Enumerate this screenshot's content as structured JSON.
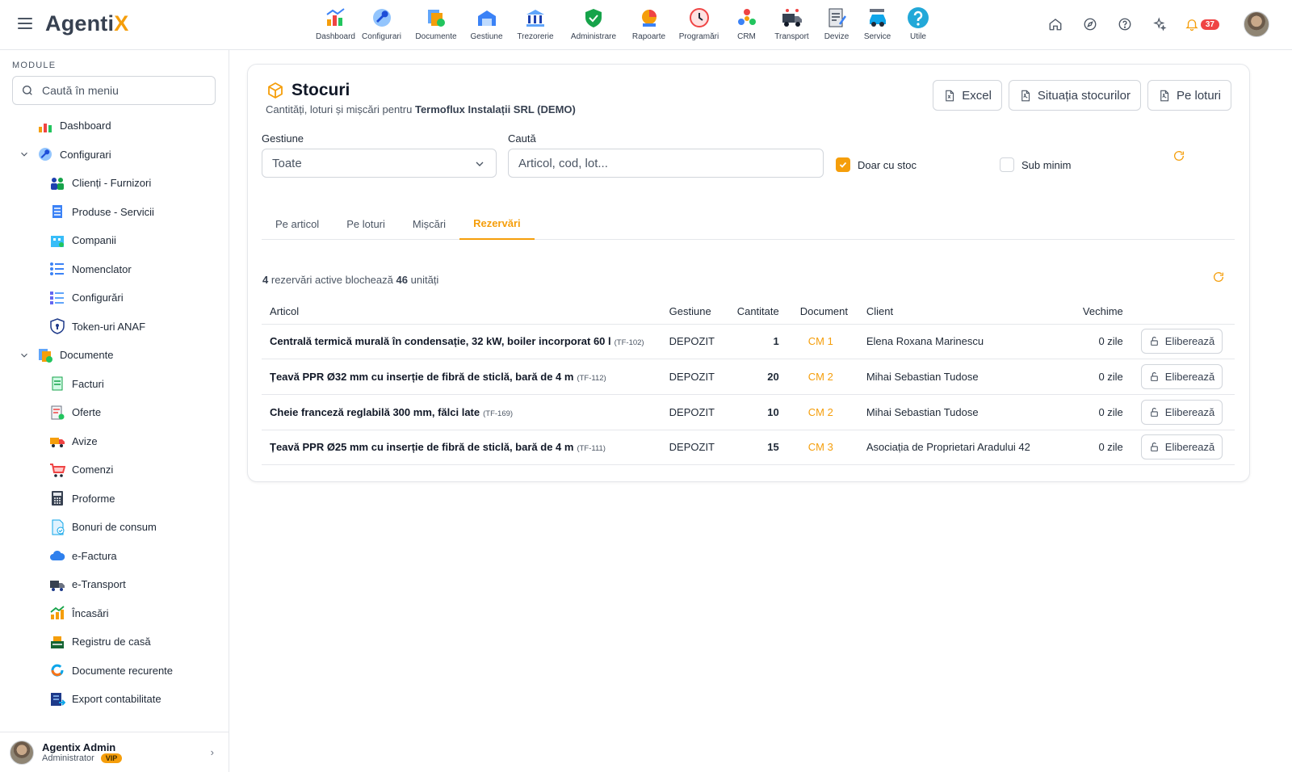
{
  "app": {
    "logo_main": "Agenti",
    "logo_accent": "X"
  },
  "modules": [
    {
      "label": "Dashboard",
      "icon": "dashboard-icon",
      "w": 47
    },
    {
      "label": "Configurari",
      "icon": "wrench-icon",
      "w": 67
    },
    {
      "label": "Documente",
      "icon": "documents-icon",
      "w": 68
    },
    {
      "label": "Gestiune",
      "icon": "warehouse-icon",
      "w": 57
    },
    {
      "label": "Trezorerie",
      "icon": "bank-icon",
      "w": 64
    },
    {
      "label": "Administrare",
      "icon": "shield-icon",
      "w": 80
    },
    {
      "label": "Rapoarte",
      "icon": "report-icon",
      "w": 57
    },
    {
      "label": "Programări",
      "icon": "clock-icon",
      "w": 67
    },
    {
      "label": "CRM",
      "icon": "crm-icon",
      "w": 51
    },
    {
      "label": "Transport",
      "icon": "truck-icon",
      "w": 61
    },
    {
      "label": "Devize",
      "icon": "estimate-icon",
      "w": 50
    },
    {
      "label": "Service",
      "icon": "car-icon",
      "w": 51
    },
    {
      "label": "Utile",
      "icon": "help-icon",
      "w": 50
    }
  ],
  "top_right": {
    "notifications_count": "37"
  },
  "sidebar": {
    "section_label": "MODULE",
    "search_placeholder": "Caută în meniu",
    "items": [
      {
        "label": "Dashboard",
        "level": 0,
        "icon": "dashboard-icon"
      },
      {
        "label": "Configurari",
        "level": 0,
        "group": true,
        "icon": "wrench-icon"
      },
      {
        "label": "Clienți - Furnizori",
        "level": 1,
        "icon": "people-icon"
      },
      {
        "label": "Produse - Servicii",
        "level": 1,
        "icon": "products-icon"
      },
      {
        "label": "Companii",
        "level": 1,
        "icon": "company-icon"
      },
      {
        "label": "Nomenclator",
        "level": 1,
        "icon": "list-icon"
      },
      {
        "label": "Configurări",
        "level": 1,
        "icon": "settings-list-icon"
      },
      {
        "label": "Token-uri ANAF",
        "level": 1,
        "icon": "token-shield-icon"
      },
      {
        "label": "Documente",
        "level": 0,
        "group": true,
        "icon": "documents-icon"
      },
      {
        "label": "Facturi",
        "level": 1,
        "icon": "invoice-icon"
      },
      {
        "label": "Oferte",
        "level": 1,
        "icon": "offer-icon"
      },
      {
        "label": "Avize",
        "level": 1,
        "icon": "delivery-truck-icon"
      },
      {
        "label": "Comenzi",
        "level": 1,
        "icon": "cart-icon"
      },
      {
        "label": "Proforme",
        "level": 1,
        "icon": "calculator-icon"
      },
      {
        "label": "Bonuri de consum",
        "level": 1,
        "icon": "receipt-icon"
      },
      {
        "label": "e-Factura",
        "level": 1,
        "icon": "cloud-icon"
      },
      {
        "label": "e-Transport",
        "level": 1,
        "icon": "transport-icon"
      },
      {
        "label": "Încasări",
        "level": 1,
        "icon": "coins-chart-icon"
      },
      {
        "label": "Registru de casă",
        "level": 1,
        "icon": "cash-register-icon"
      },
      {
        "label": "Documente recurente",
        "level": 1,
        "icon": "recurring-icon"
      },
      {
        "label": "Export contabilitate",
        "level": 1,
        "icon": "export-icon"
      }
    ],
    "user": {
      "name": "Agentix Admin",
      "role": "Administrator",
      "badge": "VIP"
    }
  },
  "page": {
    "title": "Stocuri",
    "subtitle_prefix": "Cantități, loturi și mișcări pentru",
    "company": "Termoflux Instalații SRL (DEMO)",
    "buttons": {
      "excel": "Excel",
      "situatia": "Situația stocurilor",
      "pe_loturi": "Pe loturi"
    },
    "filters": {
      "gestiune_label": "Gestiune",
      "gestiune_value": "Toate",
      "cauta_label": "Caută",
      "cauta_placeholder": "Articol, cod, lot...",
      "doar_cu_stoc": "Doar cu stoc",
      "sub_minim": "Sub minim"
    },
    "tabs": [
      "Pe articol",
      "Pe loturi",
      "Mișcări",
      "Rezervări"
    ],
    "active_tab": "Rezervări",
    "summary": {
      "count": "4",
      "text1": "rezervări active blochează",
      "units": "46",
      "text2": "unități"
    },
    "columns": {
      "articol": "Articol",
      "gestiune": "Gestiune",
      "cantitate": "Cantitate",
      "document": "Document",
      "client": "Client",
      "vechime": "Vechime"
    },
    "release_label": "Eliberează",
    "rows": [
      {
        "articol": "Centrală termică murală în condensație, 32 kW, boiler incorporat 60 l",
        "code": "(TF-102)",
        "gestiune": "DEPOZIT",
        "cantitate": "1",
        "document": "CM 1",
        "client": "Elena Roxana Marinescu",
        "vechime": "0 zile"
      },
      {
        "articol": "Țeavă PPR Ø32 mm cu inserție de fibră de sticlă, bară de 4 m",
        "code": "(TF-112)",
        "gestiune": "DEPOZIT",
        "cantitate": "20",
        "document": "CM 2",
        "client": "Mihai Sebastian Tudose",
        "vechime": "0 zile"
      },
      {
        "articol": "Cheie franceză reglabilă 300 mm, fălci late",
        "code": "(TF-169)",
        "gestiune": "DEPOZIT",
        "cantitate": "10",
        "document": "CM 2",
        "client": "Mihai Sebastian Tudose",
        "vechime": "0 zile"
      },
      {
        "articol": "Țeavă PPR Ø25 mm cu inserție de fibră de sticlă, bară de 4 m",
        "code": "(TF-111)",
        "gestiune": "DEPOZIT",
        "cantitate": "15",
        "document": "CM 3",
        "client": "Asociația de Proprietari Aradului 42",
        "vechime": "0 zile"
      }
    ]
  },
  "colors": {
    "accent": "#f59e0b",
    "badge": "#ef4444"
  }
}
